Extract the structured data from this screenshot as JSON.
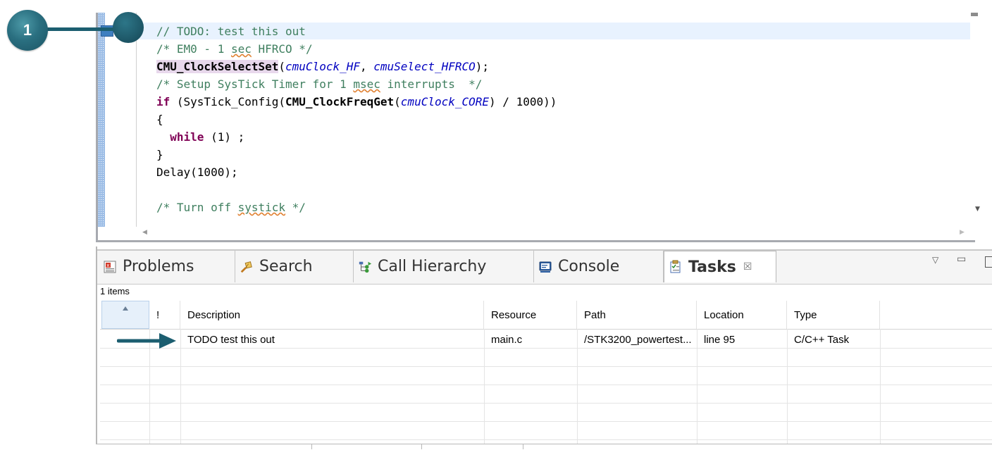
{
  "callout": {
    "number": "1"
  },
  "editor": {
    "lines": {
      "l1": "// TODO: test this out",
      "l2_pre": "/* EM0 - 1 ",
      "l2_sq": "sec",
      "l2_post": " HFRCO */",
      "l3_fn": "CMU_ClockSelectSet",
      "l3_p1": "(",
      "l3_a1": "cmuClock_HF",
      "l3_p2": ", ",
      "l3_a2": "cmuSelect_HFRCO",
      "l3_p3": ");",
      "l4_pre": "/* Setup SysTick Timer for 1 ",
      "l4_sq": "msec",
      "l4_post": " interrupts  */",
      "l5_kw": "if",
      "l5_a": " (SysTick_Config(",
      "l5_fn": "CMU_ClockFreqGet",
      "l5_b": "(",
      "l5_arg": "cmuClock_CORE",
      "l5_c": ") / 1000))",
      "l6": "{",
      "l7_indent": "  ",
      "l7_kw": "while",
      "l7_rest": " (1) ;",
      "l8": "}",
      "l9": "Delay(1000);",
      "l10_pre": "/* Turn off ",
      "l10_sq": "systick",
      "l10_post": " */"
    }
  },
  "tabs": [
    {
      "label": "Problems",
      "icon": "problems-icon"
    },
    {
      "label": "Search",
      "icon": "search-icon"
    },
    {
      "label": "Call Hierarchy",
      "icon": "call-hierarchy-icon"
    },
    {
      "label": "Console",
      "icon": "console-icon"
    },
    {
      "label": "Tasks",
      "icon": "tasks-icon",
      "active": true,
      "close": "☒"
    }
  ],
  "view": {
    "items_count": "1 items"
  },
  "table": {
    "columns": [
      "!",
      "Description",
      "Resource",
      "Path",
      "Location",
      "Type"
    ],
    "rows": [
      {
        "priority": "",
        "description": "TODO test this out",
        "resource": "main.c",
        "path": "/STK3200_powertest...",
        "location": "line 95",
        "type": "C/C++ Task"
      }
    ]
  },
  "colors": {
    "callout": "#1c5e70",
    "comment": "#3f7f5f",
    "keyword": "#7f0055",
    "param": "#0000c0",
    "current_line": "#e8f2fe"
  }
}
